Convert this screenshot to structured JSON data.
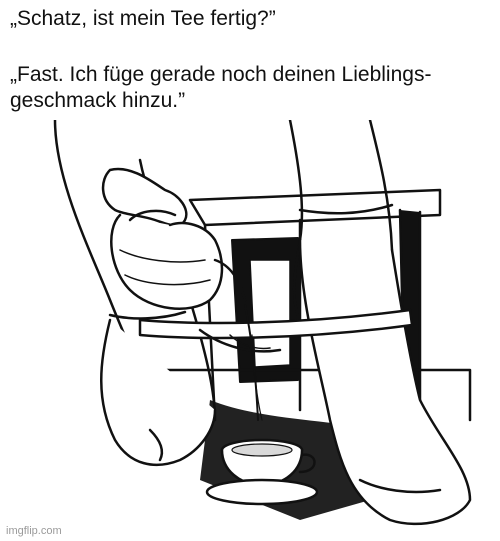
{
  "caption": {
    "line1": "„Schatz, ist mein Tee fertig?”",
    "line2": "„Fast. Ich füge gerade noch deinen Lieblings-\ngeschmack hinzu.”"
  },
  "watermark": "imgflip.com"
}
